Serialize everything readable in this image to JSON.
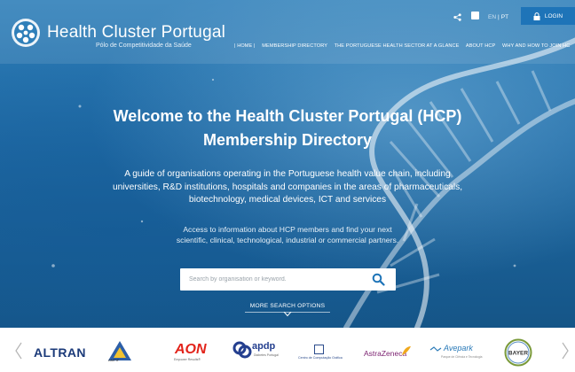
{
  "brand": {
    "name": "Health Cluster Portugal",
    "subtitle": "Pólo de Competitividade da Saúde"
  },
  "topbar": {
    "lang_en": "EN",
    "lang_sep": "|",
    "lang_pt": "PT",
    "login_label": "LOGIN"
  },
  "nav": {
    "items": [
      "| HOME |",
      "MEMBERSHIP DIRECTORY",
      "THE PORTUGUESE HEALTH SECTOR AT A GLANCE",
      "ABOUT HCP",
      "WHY AND HOW TO JOIN HC"
    ]
  },
  "hero": {
    "title_line1": "Welcome to the Health Cluster Portugal (HCP)",
    "title_line2": "Membership Directory",
    "description": "A guide of organisations operating in the Portuguese health value chain, including universities, R&D institutions, hospitals and companies in the areas of pharmaceuticals, biotechnology, medical devices, ICT and services",
    "access_text": "Access to information about HCP members and find your next scientific, clinical, technological, industrial or commercial partners."
  },
  "search": {
    "placeholder": "Search by organisation or keyword.",
    "value": "",
    "more_options": "MORE SEARCH OPTIONS"
  },
  "partners": {
    "altran": "ALTRAN",
    "ampif": "AMPIF",
    "aon": "AON",
    "aon_tagline": "Empower Results®",
    "apdp": "apdp",
    "apdp_tagline": "Diabetes Portugal",
    "ccg": "Centro de Computação Gráfica",
    "astrazeneca": "AstraZeneca",
    "avepark": "Avepark",
    "avepark_tagline": "Parque de Ciência e Tecnologia",
    "bayer": "BAYER"
  },
  "colors": {
    "login_bg": "#1e74b8",
    "hero_blue": "#1f6aa5",
    "search_icon": "#1e74b8"
  }
}
